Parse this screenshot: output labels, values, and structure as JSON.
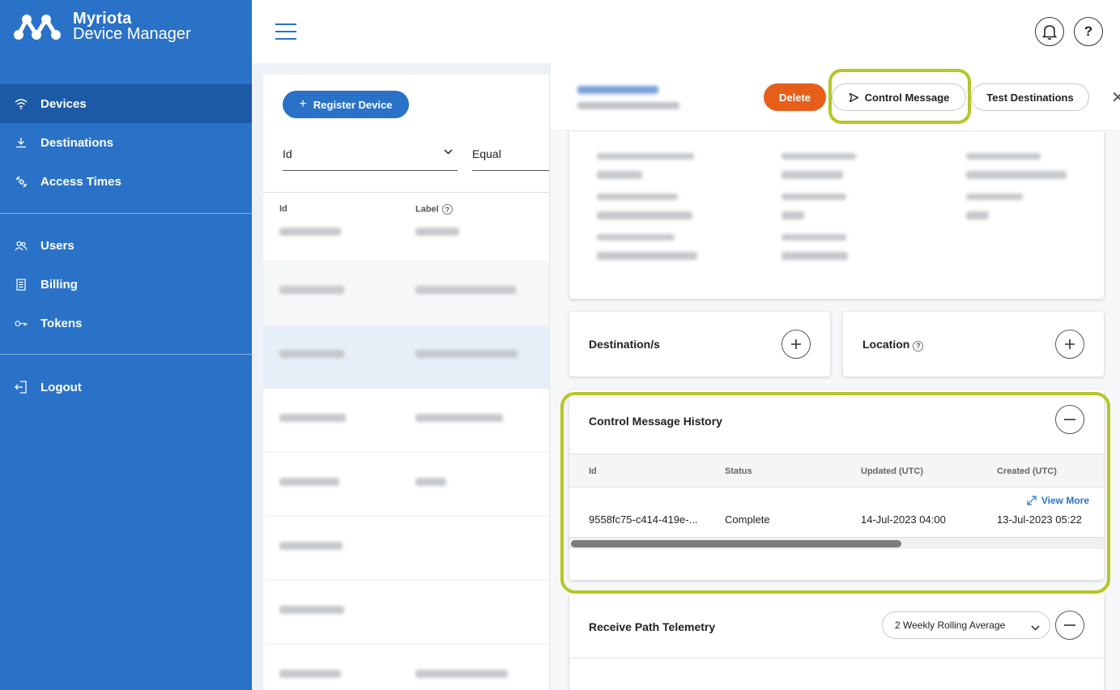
{
  "brand": {
    "line1": "Myriota",
    "line2": "Device Manager"
  },
  "sidebar": {
    "items": [
      {
        "label": "Devices",
        "icon": "wifi-icon"
      },
      {
        "label": "Destinations",
        "icon": "download-icon"
      },
      {
        "label": "Access Times",
        "icon": "satellite-icon"
      },
      {
        "label": "Users",
        "icon": "users-icon"
      },
      {
        "label": "Billing",
        "icon": "receipt-icon"
      },
      {
        "label": "Tokens",
        "icon": "key-icon"
      },
      {
        "label": "Logout",
        "icon": "logout-icon"
      }
    ]
  },
  "topbar": {
    "help_label": "?"
  },
  "list": {
    "register_label": "Register Device",
    "filter_field": "Id",
    "filter_op": "Equal",
    "columns": {
      "id": "Id",
      "label": "Label"
    }
  },
  "panel": {
    "delete_label": "Delete",
    "control_message_label": "Control Message",
    "test_destinations_label": "Test Destinations",
    "destinations_title": "Destination/s",
    "location_title": "Location",
    "history": {
      "title": "Control Message History",
      "columns": {
        "id": "Id",
        "status": "Status",
        "updated": "Updated (UTC)",
        "created": "Created (UTC)"
      },
      "rows": [
        {
          "id": "9558fc75-c414-419e-...",
          "status": "Complete",
          "updated": "14-Jul-2023 04:00",
          "created": "13-Jul-2023 05:22"
        }
      ],
      "view_more": "View More"
    },
    "telemetry": {
      "title": "Receive Path Telemetry",
      "select_value": "2 Weekly Rolling Average"
    }
  },
  "colors": {
    "sidebar": "#2a72c7",
    "accent": "#2a72c7",
    "delete": "#e55f1b",
    "highlight": "#b4c726"
  }
}
